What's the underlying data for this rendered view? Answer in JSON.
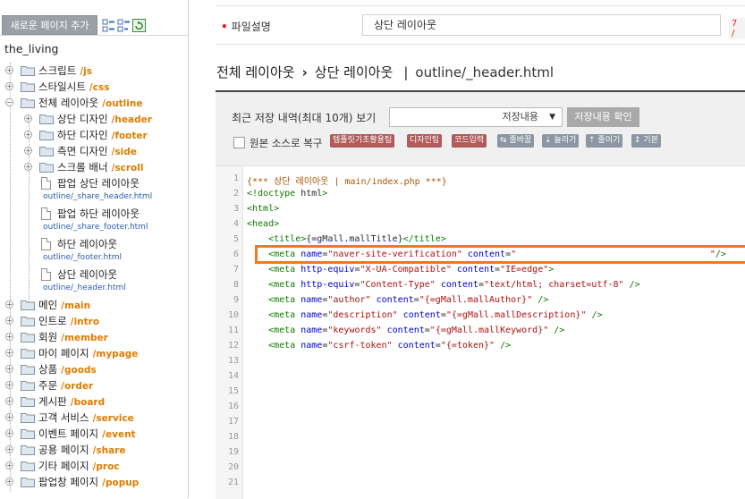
{
  "sidebar": {
    "add_page_label": "새로운 페이지 추가",
    "site_name": "the_living",
    "tree": [
      {
        "label": "스크립트",
        "path": "/js",
        "kind": "folder"
      },
      {
        "label": "스타일시트",
        "path": "/css",
        "kind": "folder"
      },
      {
        "label": "전체 레이아웃",
        "path": "/outline",
        "kind": "folder-open"
      },
      {
        "label": "상단 디자인",
        "path": "/header",
        "kind": "folder"
      },
      {
        "label": "하단 디자인",
        "path": "/footer",
        "kind": "folder"
      },
      {
        "label": "측면 디자인",
        "path": "/side",
        "kind": "folder"
      },
      {
        "label": "스크롤 배너",
        "path": "/scroll",
        "kind": "folder"
      },
      {
        "label": "팝업 상단 레이아웃",
        "file": "outline/_share_header.html",
        "kind": "file"
      },
      {
        "label": "팝업 하단 레이아웃",
        "file": "outline/_share_footer.html",
        "kind": "file"
      },
      {
        "label": "하단 레이아웃",
        "file": "outline/_footer.html",
        "kind": "file"
      },
      {
        "label": "상단 레이아웃",
        "file": "outline/_header.html",
        "kind": "file"
      },
      {
        "label": "메인",
        "path": "/main",
        "kind": "folder"
      },
      {
        "label": "인트로",
        "path": "/intro",
        "kind": "folder"
      },
      {
        "label": "회원",
        "path": "/member",
        "kind": "folder"
      },
      {
        "label": "마이 페이지",
        "path": "/mypage",
        "kind": "folder"
      },
      {
        "label": "상품",
        "path": "/goods",
        "kind": "folder"
      },
      {
        "label": "주문",
        "path": "/order",
        "kind": "folder"
      },
      {
        "label": "게시판",
        "path": "/board",
        "kind": "folder"
      },
      {
        "label": "고객 서비스",
        "path": "/service",
        "kind": "folder"
      },
      {
        "label": "이벤트 페이지",
        "path": "/event",
        "kind": "folder"
      },
      {
        "label": "공용 페이지",
        "path": "/share",
        "kind": "folder"
      },
      {
        "label": "기타 페이지",
        "path": "/proc",
        "kind": "folder"
      },
      {
        "label": "팝업창 페이지",
        "path": "/popup",
        "kind": "folder"
      }
    ]
  },
  "description": {
    "label": "파일설명",
    "value": "상단 레이아웃",
    "counter": "7 /"
  },
  "breadcrumb": {
    "root": "전체 레이아웃",
    "current": "상단 레이아웃",
    "file": "outline/_header.html"
  },
  "history": {
    "label": "최근 저장 내역(최대 10개) 보기",
    "select_value": "저장내용",
    "confirm_label": "저장내용 확인",
    "restore_label": "원본 소스로 복구",
    "tags": [
      "템플릿기초활용팁",
      "디자인팁",
      "코드입력"
    ],
    "tools": [
      "줄바꿈",
      "늘리기",
      "줄이기",
      "기본"
    ]
  },
  "editor": {
    "line_numbers": [
      "1",
      "2",
      "3",
      "4",
      "5",
      "6",
      "7",
      "8",
      "9",
      "10",
      "11",
      "12",
      "13",
      "14",
      "15",
      "16",
      "17",
      "18",
      "19",
      "20",
      "21"
    ],
    "lines": [
      "{*** 상단 레이아웃 | main/index.php ***}",
      "<!doctype html>",
      "<html>",
      "<head>",
      "    <title>{=gMall.mallTitle}</title>",
      "    <meta name=\"naver-site-verification\" content=\"                                    \"/>",
      "    <meta http-equiv=\"X-UA-Compatible\" content=\"IE=edge\">",
      "    <meta http-equiv=\"Content-Type\" content=\"text/html; charset=utf-8\" />",
      "    <meta name=\"author\" content=\"{=gMall.mallAuthor}\" />",
      "    <meta name=\"description\" content=\"{=gMall.mallDescription}\" />",
      "    <meta name=\"keywords\" content=\"{=gMall.mallKeyword}\" />",
      "    <meta name=\"csrf-token\" content=\"{=token}\" />",
      "",
      "",
      "",
      "",
      "",
      "",
      "",
      "",
      ""
    ],
    "highlight_color": "#f07a1a"
  },
  "colors": {
    "path_orange": "#e07b00",
    "file_blue": "#2a5db0",
    "tag_red": "#b05a5a",
    "tool_gray": "#8c96a2"
  }
}
